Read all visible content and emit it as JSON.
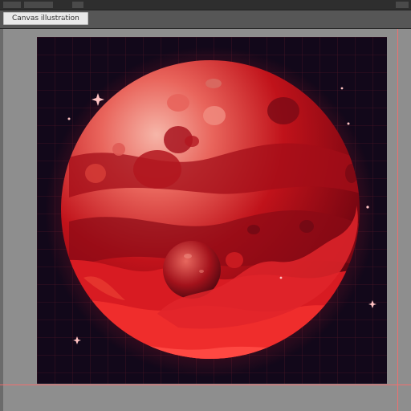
{
  "app": {
    "document_tab": {
      "label": "Canvas illustration"
    },
    "colors": {
      "accent_guide": "#ff6a6a",
      "planet_red": "#c0121a",
      "planet_highlight": "#f6a39a",
      "space": "#0e0714"
    },
    "icons": {
      "tab_close": "close-icon"
    }
  }
}
